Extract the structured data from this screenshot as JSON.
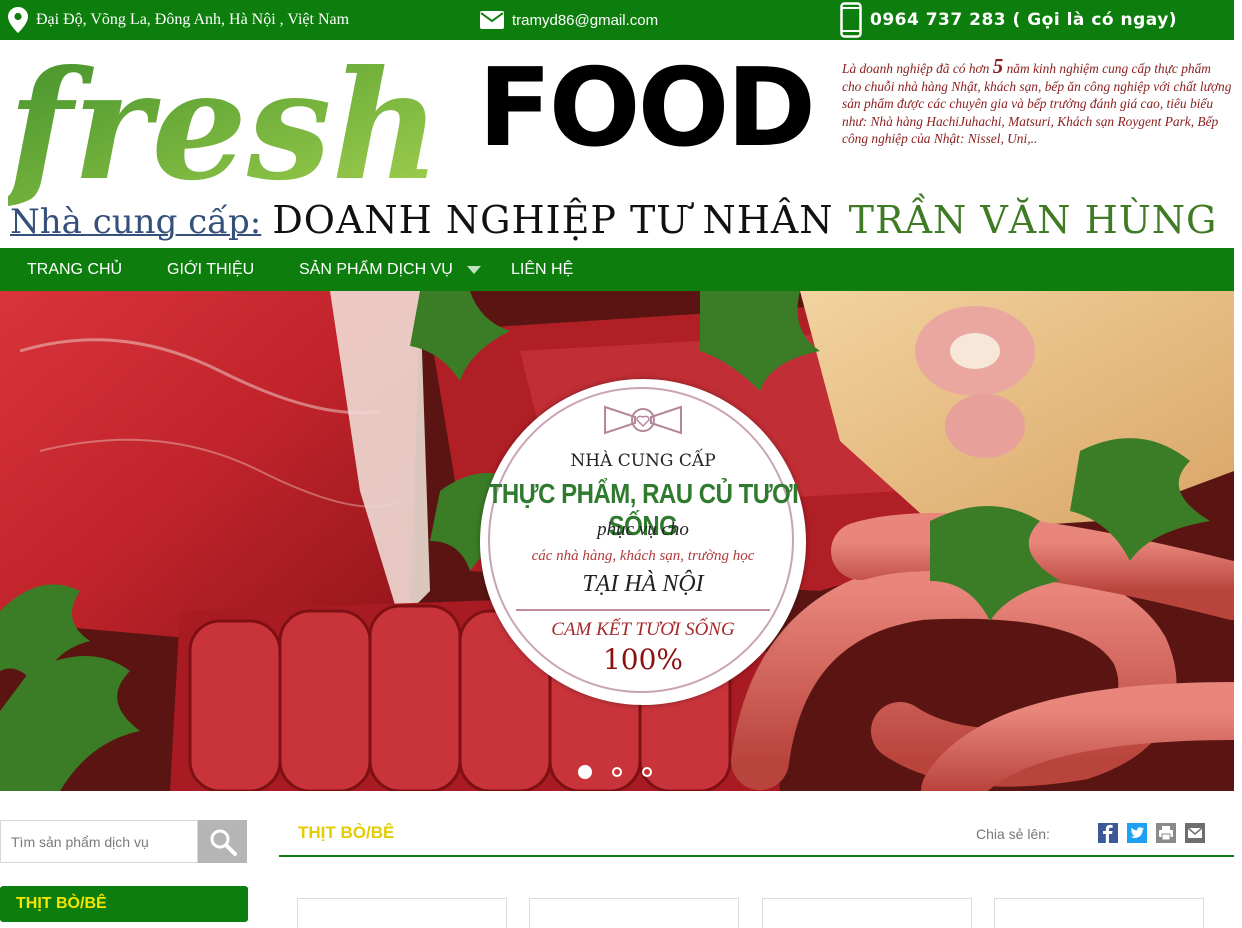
{
  "topbar": {
    "address": "Đại Độ, Võng La, Đông Anh, Hà Nội , Việt Nam",
    "email": "tramyd86@gmail.com",
    "phone": "0964 737 283 ( Gọi là có ngay)",
    "icons": [
      "map-pin-icon",
      "mail-icon",
      "phone-icon"
    ]
  },
  "header": {
    "logo_fresh": "fresh",
    "logo_food": "FOOD",
    "intro_before": "Là doanh nghiệp đã có hơn ",
    "intro_number": "5",
    "intro_after": " năm kinh nghiệm cung cấp thực phẩm cho chuỗi nhà hàng Nhật, khách sạn, bếp ăn công nghiệp với chất lượng sản phẩm được các chuyên gia và bếp trưởng đánh giá cao, tiêu biểu như: Nhà hàng HachiJuhachi, Matsuri, Khách sạn Roygent Park, Bếp công nghiệp của Nhật: Nissel, Uni,..",
    "supplier_label": "Nhà cung cấp:",
    "supplier_business": "DOANH NGHIỆP TƯ NHÂN",
    "supplier_owner": "TRẦN VĂN HÙNG"
  },
  "nav": {
    "items": [
      {
        "label": "TRANG CHỦ"
      },
      {
        "label": "GIỚI THIỆU"
      },
      {
        "label": "SẢN PHẨM DỊCH VỤ"
      },
      {
        "label": "LIÊN HỆ"
      }
    ]
  },
  "banner": {
    "badge": {
      "line1": "NHÀ CUNG CẤP",
      "line2": "THỰC PHẨM, RAU CỦ TƯƠI SỐNG",
      "line3": "phục vụ cho",
      "line4": "các nhà hàng, khách sạn, trường học",
      "line5": "TẠI HÀ NỘI",
      "line6": "CAM KẾT TƯƠI SỐNG",
      "line7": "100%"
    },
    "slides_total": 3,
    "active_slide": 1
  },
  "sidebar": {
    "search_placeholder": "Tìm sản phẩm dịch vụ",
    "category_button": "THỊT BÒ/BÊ"
  },
  "main": {
    "section_title": "THỊT BÒ/BÊ",
    "share_label": "Chia sẻ lên:",
    "share_icons": [
      "facebook-icon",
      "twitter-icon",
      "print-icon",
      "email-icon"
    ]
  },
  "colors": {
    "brand_green": "#0d7e0d",
    "title_yellow": "#e5cc00",
    "intro_red": "#8a1c1c",
    "owner_green": "#3f7a25"
  }
}
